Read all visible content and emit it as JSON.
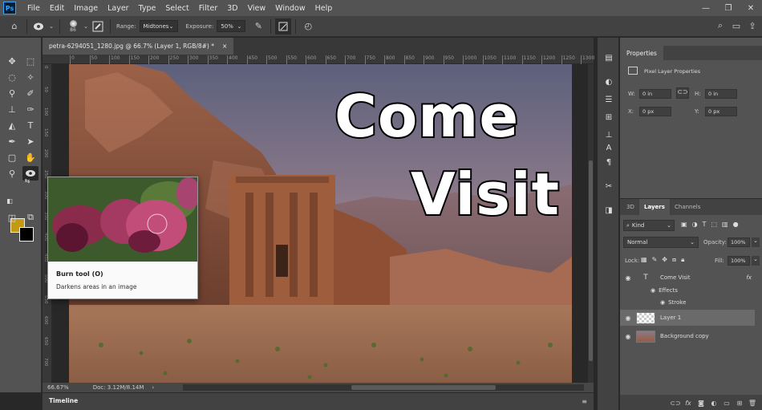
{
  "app": {
    "logo_text": "Ps"
  },
  "menu": [
    "File",
    "Edit",
    "Image",
    "Layer",
    "Type",
    "Select",
    "Filter",
    "3D",
    "View",
    "Window",
    "Help"
  ],
  "options_bar": {
    "brush_size": "86",
    "range_label": "Range:",
    "range_value": "Midtones",
    "exposure_label": "Exposure:",
    "exposure_value": "50%"
  },
  "document": {
    "tab_title": "petra-6294051_1280.jpg @ 66.7% (Layer 1, RGB/8#) *",
    "close_glyph": "×",
    "ruler_ticks": [
      "0",
      "50",
      "100",
      "150",
      "200",
      "250",
      "300",
      "350",
      "400",
      "450",
      "500",
      "550",
      "600",
      "650",
      "700",
      "750",
      "800",
      "850",
      "900",
      "950",
      "1000",
      "1050",
      "1100",
      "1150",
      "1200",
      "1250",
      "1300"
    ],
    "ruler_left_ticks": [
      "0",
      "50",
      "100",
      "150",
      "200",
      "250",
      "300",
      "350",
      "400",
      "450",
      "500",
      "550",
      "600",
      "650",
      "700"
    ],
    "canvas_text_line1": "Come",
    "canvas_text_line2": "Visit"
  },
  "tooltip": {
    "title": "Burn tool (O)",
    "description": "Darkens areas in an image"
  },
  "status": {
    "zoom": "66.67%",
    "doc_info": "Doc: 3.12M/8.14M",
    "arrow": "›"
  },
  "timeline": {
    "label": "Timeline"
  },
  "properties": {
    "tab": "Properties",
    "subtitle": "Pixel Layer Properties",
    "w_label": "W:",
    "w_value": "0 in",
    "h_label": "H:",
    "h_value": "0 in",
    "x_label": "X:",
    "x_value": "0 px",
    "y_label": "Y:",
    "y_value": "0 px"
  },
  "layers_panel": {
    "tabs": [
      "3D",
      "Layers",
      "Channels"
    ],
    "kind_label": "Kind",
    "blend_mode": "Normal",
    "opacity_label": "Opacity:",
    "opacity_value": "100%",
    "lock_label": "Lock:",
    "fill_label": "Fill:",
    "fill_value": "100%",
    "layers": [
      {
        "name": "Come Visit",
        "type": "text"
      },
      {
        "name": "Effects",
        "type": "effects"
      },
      {
        "name": "Stroke",
        "type": "effect-item"
      },
      {
        "name": "Layer 1",
        "type": "pixel",
        "selected": true
      },
      {
        "name": "Background copy",
        "type": "image"
      }
    ],
    "fx_label": "fx"
  },
  "colors": {
    "foreground": "#c49a12",
    "background": "#000000",
    "ui_dark": "#282828",
    "ui_panel": "#535353",
    "accent": "#31a8ff"
  }
}
